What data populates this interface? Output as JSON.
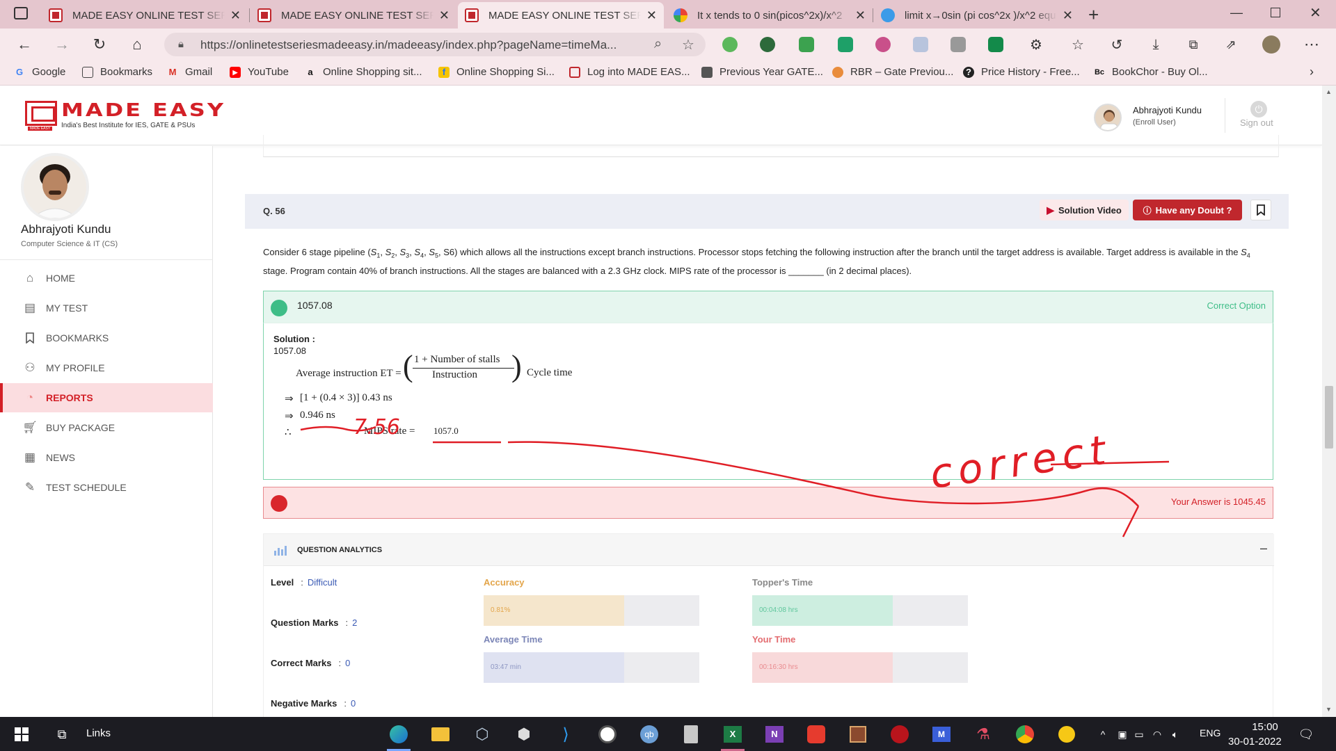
{
  "tabs": [
    {
      "title": "MADE EASY ONLINE TEST SERIES",
      "icon": "made-easy-favicon"
    },
    {
      "title": "MADE EASY ONLINE TEST SERIES",
      "icon": "made-easy-favicon"
    },
    {
      "title": "MADE EASY ONLINE TEST SERIES",
      "icon": "made-easy-favicon"
    },
    {
      "title": "It x tends to 0 sin(picos^2x)/x^2",
      "icon": "google-favicon"
    },
    {
      "title": "limit x→0sin (pi cos^2x )/x^2 equ",
      "icon": "upload-favicon"
    }
  ],
  "address_bar": {
    "url": "https://onlinetestseriesmadeeasy.in/madeeasy/index.php?pageName=timeMa..."
  },
  "bookmarks": [
    {
      "label": "Google",
      "icon": "google-icon"
    },
    {
      "label": "Bookmarks",
      "icon": "file-icon"
    },
    {
      "label": "Gmail",
      "icon": "gmail-icon"
    },
    {
      "label": "YouTube",
      "icon": "youtube-icon"
    },
    {
      "label": "Online Shopping sit...",
      "icon": "amazon-icon"
    },
    {
      "label": "Online Shopping Si...",
      "icon": "flipkart-icon"
    },
    {
      "label": "Log into MADE EAS...",
      "icon": "made-easy-icon"
    },
    {
      "label": "Previous Year GATE...",
      "icon": "gate-icon"
    },
    {
      "label": "RBR – Gate Previou...",
      "icon": "rbr-icon"
    },
    {
      "label": "Price History - Free...",
      "icon": "price-history-icon"
    },
    {
      "label": "BookChor - Buy Ol...",
      "icon": "bookchor-icon"
    }
  ],
  "header": {
    "brand": "MADE EASY",
    "tagline": "India's Best Institute for IES, GATE & PSUs",
    "logo_sub": "MADE EASY",
    "user_name": "Abhrajyoti Kundu",
    "user_role": "(Enroll User)",
    "sign_out": "Sign out"
  },
  "sidebar": {
    "name": "Abhrajyoti Kundu",
    "branch": "Computer Science & IT (CS)",
    "items": [
      {
        "label": "HOME",
        "icon": "home-icon"
      },
      {
        "label": "MY TEST",
        "icon": "test-icon"
      },
      {
        "label": "BOOKMARKS",
        "icon": "bookmark-icon"
      },
      {
        "label": "MY PROFILE",
        "icon": "user-icon"
      },
      {
        "label": "REPORTS",
        "icon": "chart-icon",
        "active": true
      },
      {
        "label": "BUY PACKAGE",
        "icon": "cart-icon"
      },
      {
        "label": "NEWS",
        "icon": "news-icon"
      },
      {
        "label": "TEST SCHEDULE",
        "icon": "schedule-icon"
      }
    ]
  },
  "question": {
    "number": "Q. 56",
    "solution_video": "Solution Video",
    "have_doubt": "Have any Doubt ?",
    "text_part1": "Consider 6 stage pipeline (",
    "s": "S",
    "subs": [
      "1",
      "2",
      "3",
      "4",
      "5"
    ],
    "text_part2": "S6) which allows all the instructions except branch instructions. Processor stops fetching the following instruction after the branch until the target address is available. Target address is available in the ",
    "text_part3": " stage. Program contain 40% of branch instructions. All the stages are balanced with a 2.3 GHz clock. MIPS rate of the processor is _______ (in 2 decimal places).",
    "correct_value": "1057.08",
    "correct_label": "Correct Option",
    "your_answer": "Your Answer is 1045.45"
  },
  "solution": {
    "title": "Solution :",
    "value": "1057.08",
    "line1_left": "Average instruction ET  =",
    "numerator": "1 + Number of stalls",
    "denominator": "Instruction",
    "line1_right": "Cycle time",
    "arrow": "⇒",
    "line2": "[1 + (0.4 × 3)] 0.43 ns",
    "line3": "0.946 ns",
    "therefore": "∴",
    "line4_left": "MIPS rate  =",
    "line4_right": "1057.0"
  },
  "analytics": {
    "title": "QUESTION ANALYTICS",
    "collapse": "–",
    "level_label": "Level",
    "level_value": "Difficult",
    "marks_label": "Question Marks",
    "marks_value": "2",
    "correct_marks_label": "Correct Marks",
    "correct_marks_value": "0",
    "negative_marks_label": "Negative Marks",
    "negative_marks_value": "0",
    "accuracy_label": "Accuracy",
    "accuracy_value": "0.81%",
    "accuracy_fill": 0.65,
    "topper_label": "Topper's Time",
    "topper_value": "00:04:08 hrs",
    "topper_fill": 0.65,
    "avg_label": "Average Time",
    "avg_value": "03:47 min",
    "avg_fill": 0.65,
    "your_label": "Your Time",
    "your_value": "00:16:30 hrs",
    "your_fill": 0.65
  },
  "annotation": {
    "text": "correct",
    "value": "7.56"
  },
  "taskbar": {
    "links": "Links",
    "language": "ENG",
    "time": "15:00",
    "date": "30-01-2022"
  },
  "colors": {
    "brand_red": "#d32027",
    "correct_green": "#3ebd87",
    "wrong_red": "#d9262c",
    "tab_strip": "#e5c6ce"
  }
}
